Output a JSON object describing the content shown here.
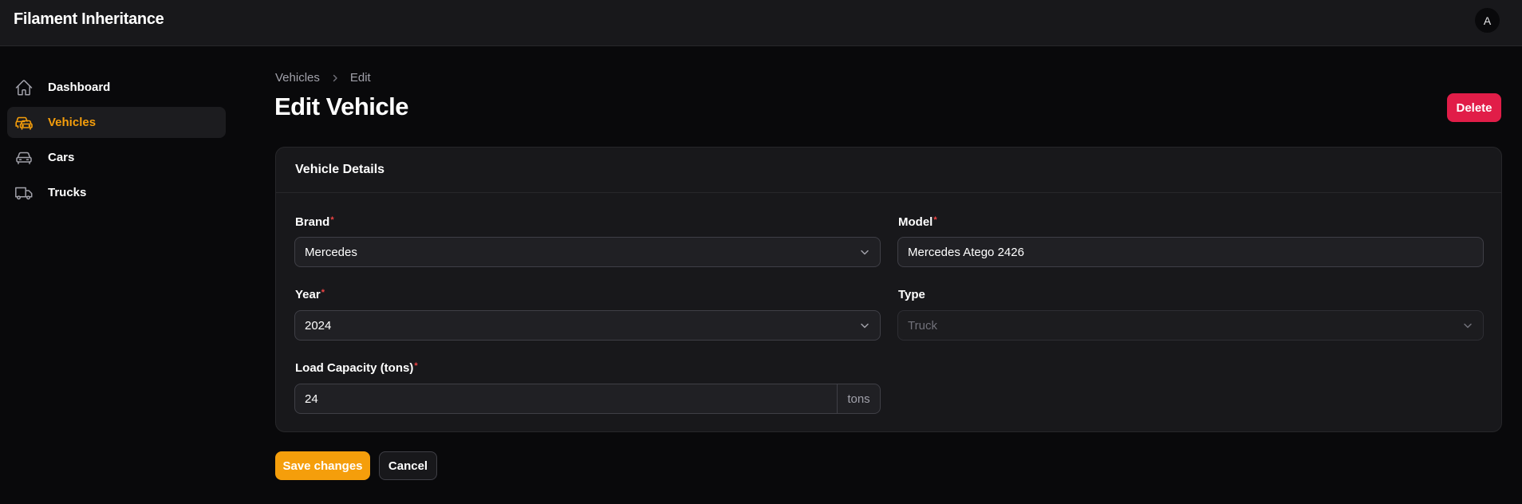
{
  "app": {
    "title": "Filament Inheritance",
    "user_initial": "A"
  },
  "sidebar": {
    "items": [
      {
        "label": "Dashboard",
        "icon": "home-icon",
        "active": false
      },
      {
        "label": "Vehicles",
        "icon": "vehicles-icon",
        "active": true
      },
      {
        "label": "Cars",
        "icon": "car-icon",
        "active": false
      },
      {
        "label": "Trucks",
        "icon": "truck-icon",
        "active": false
      }
    ]
  },
  "breadcrumb": {
    "items": [
      "Vehicles",
      "Edit"
    ]
  },
  "page": {
    "title": "Edit Vehicle",
    "delete_label": "Delete"
  },
  "form": {
    "section_title": "Vehicle Details",
    "required_marker": "*",
    "brand": {
      "label": "Brand",
      "value": "Mercedes",
      "required": true
    },
    "model": {
      "label": "Model",
      "value": "Mercedes Atego 2426",
      "required": true
    },
    "year": {
      "label": "Year",
      "value": "2024",
      "required": true
    },
    "type": {
      "label": "Type",
      "value": "Truck",
      "required": false,
      "disabled": true
    },
    "load_capacity": {
      "label": "Load Capacity (tons)",
      "value": "24",
      "suffix": "tons",
      "required": true
    }
  },
  "actions": {
    "save_label": "Save changes",
    "cancel_label": "Cancel"
  },
  "colors": {
    "accent": "#f59e0b",
    "danger": "#e11d48",
    "background": "#09090b",
    "surface": "#18181b"
  }
}
